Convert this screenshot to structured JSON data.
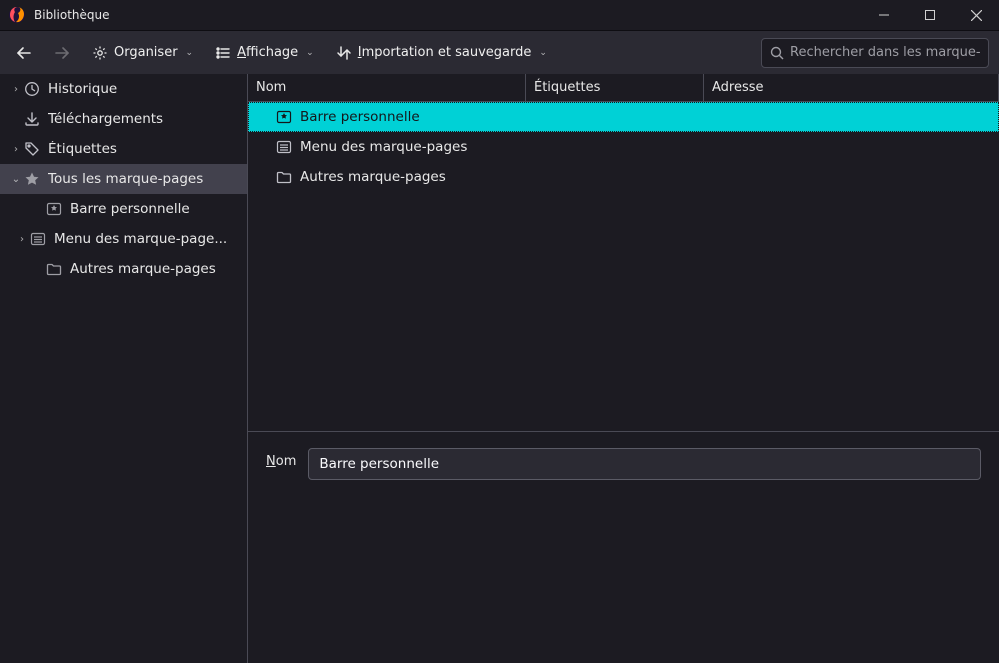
{
  "window": {
    "title": "Bibliothèque"
  },
  "toolbar": {
    "organize": "Organiser",
    "views": "Affichage",
    "import": "Importation et sauvegarde"
  },
  "search": {
    "placeholder": "Rechercher dans les marque-pages"
  },
  "tree": {
    "history": "Historique",
    "downloads": "Téléchargements",
    "tags": "Étiquettes",
    "all_bookmarks": "Tous les marque-pages",
    "toolbar_bm": "Barre personnelle",
    "menu_bm": "Menu des marque-page...",
    "other_bm": "Autres marque-pages"
  },
  "columns": {
    "name": "Nom",
    "tags": "Étiquettes",
    "address": "Adresse"
  },
  "list": {
    "toolbar_bm": "Barre personnelle",
    "menu_bm": "Menu des marque-pages",
    "other_bm": "Autres marque-pages"
  },
  "detail": {
    "name_label": "Nom",
    "name_value": "Barre personnelle"
  }
}
